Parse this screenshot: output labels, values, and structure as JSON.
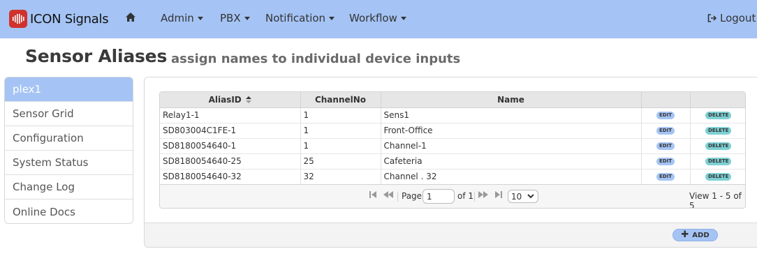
{
  "navbar": {
    "brand": "ICON Signals",
    "menus": [
      {
        "label": "Admin"
      },
      {
        "label": "PBX"
      },
      {
        "label": "Notification"
      },
      {
        "label": "Workflow"
      }
    ],
    "logout": "Logout"
  },
  "page": {
    "title": "Sensor Aliases",
    "subtitle": "assign names to individual device inputs"
  },
  "sidebar": {
    "items": [
      {
        "label": "plex1",
        "active": true
      },
      {
        "label": "Sensor Grid"
      },
      {
        "label": "Configuration"
      },
      {
        "label": "System Status"
      },
      {
        "label": "Change Log"
      },
      {
        "label": "Online Docs"
      }
    ]
  },
  "grid": {
    "headers": {
      "alias": "AliasID",
      "channel": "ChannelNo",
      "name": "Name"
    },
    "rows": [
      {
        "alias": "Relay1-1",
        "channel": "1",
        "name": "Sens1",
        "edit": "EDIT",
        "delete": "DELETE"
      },
      {
        "alias": "SD803004C1FE-1",
        "channel": "1",
        "name": "Front-Office",
        "edit": "EDIT",
        "delete": "DELETE"
      },
      {
        "alias": "SD8180054640-1",
        "channel": "1",
        "name": "Channel-1",
        "edit": "EDIT",
        "delete": "DELETE"
      },
      {
        "alias": "SD8180054640-25",
        "channel": "25",
        "name": "Cafeteria",
        "edit": "EDIT",
        "delete": "DELETE"
      },
      {
        "alias": "SD8180054640-32",
        "channel": "32",
        "name": "Channel . 32",
        "edit": "EDIT",
        "delete": "DELETE"
      }
    ],
    "pager": {
      "page_label": "Page",
      "page_value": "1",
      "of_label": "of 1",
      "rows_per_page": "10",
      "view_text": "View 1 - 5 of 5"
    }
  },
  "actions": {
    "add_label": "ADD"
  },
  "colors": {
    "navbar": "#a5c4f5",
    "brand_logo": "#d0322e",
    "edit_pill": "#a5c4f5",
    "delete_pill": "#7ed0d3"
  }
}
